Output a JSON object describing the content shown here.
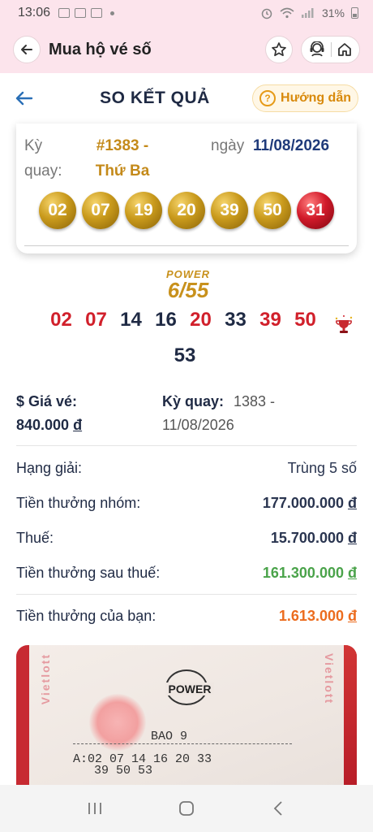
{
  "status": {
    "time": "13:06",
    "battery": "31%"
  },
  "app_bar": {
    "title": "Mua hộ vé số"
  },
  "page": {
    "title": "SO KẾT QUẢ",
    "guide_label": "Hướng dẫn"
  },
  "result_card": {
    "ky_label": "Kỳ quay:",
    "draw_hash": "#1383",
    "draw_day": "- Thứ Ba",
    "ngay_label": "ngày",
    "date": "11/08/2026",
    "balls": [
      {
        "value": "02",
        "color": "#c99a1c"
      },
      {
        "value": "07",
        "color": "#c99a1c"
      },
      {
        "value": "19",
        "color": "#c99a1c"
      },
      {
        "value": "20",
        "color": "#c99a1c"
      },
      {
        "value": "39",
        "color": "#c99a1c"
      },
      {
        "value": "50",
        "color": "#c99a1c"
      },
      {
        "value": "31",
        "color": "#d11a2a"
      }
    ]
  },
  "game_logo": {
    "top": "POWER",
    "main": "6/55"
  },
  "ticket_numbers": [
    {
      "value": "02",
      "matched": true
    },
    {
      "value": "07",
      "matched": true
    },
    {
      "value": "14",
      "matched": false
    },
    {
      "value": "16",
      "matched": false
    },
    {
      "value": "20",
      "matched": true
    },
    {
      "value": "33",
      "matched": false
    },
    {
      "value": "39",
      "matched": true
    },
    {
      "value": "50",
      "matched": true
    }
  ],
  "ticket_bonus": "53",
  "info": {
    "price_label": "$ Giá vé:",
    "price_value": "840.000",
    "currency": "đ",
    "ky_label": "Kỳ quay:",
    "ky_value_line1": "1383 -",
    "ky_value_line2": "11/08/2026"
  },
  "prizes": {
    "rank_label": "Hạng giải:",
    "rank_value": "Trùng 5 số",
    "group_label": "Tiền thưởng nhóm:",
    "group_value": "177.000.000",
    "tax_label": "Thuế:",
    "tax_value": "15.700.000",
    "after_tax_label": "Tiền thưởng sau thuế:",
    "after_tax_value": "161.300.000",
    "yours_label": "Tiền thưởng của bạn:",
    "yours_value": "1.613.000",
    "currency": "đ"
  },
  "ticket_image": {
    "brand": "Vietlott",
    "logo": "POWER",
    "bao": "BAO  9",
    "line1": "A:02  07  14  16  20  33",
    "line2": "39  50  53"
  },
  "colors": {
    "header_bg": "#fce4ec",
    "matched": "#d1202b",
    "unmatched": "#1f2a44",
    "after_tax": "#4aa34a",
    "yours": "#ec6c1e"
  }
}
